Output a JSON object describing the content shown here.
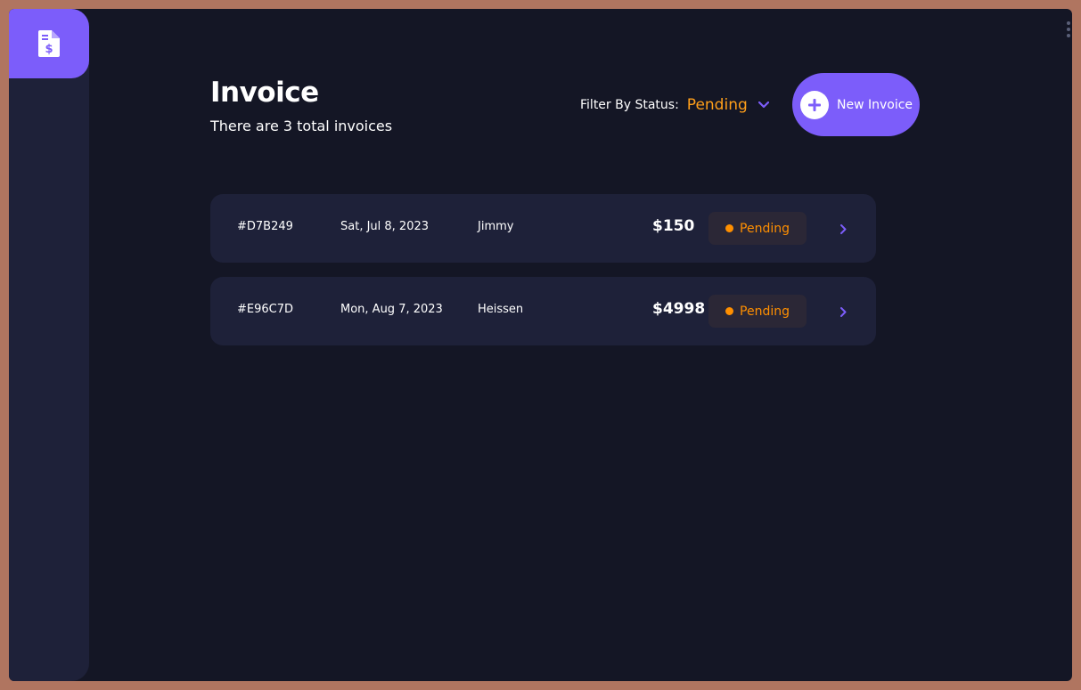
{
  "header": {
    "title": "Invoice",
    "subtitle": "There are 3 total invoices"
  },
  "filter": {
    "label": "Filter By Status:",
    "value": "Pending"
  },
  "new_invoice": {
    "label": "New Invoice"
  },
  "invoices": [
    {
      "id": "#D7B249",
      "date": "Sat, Jul 8, 2023",
      "client": "Jimmy",
      "amount": "$150",
      "status": "Pending"
    },
    {
      "id": "#E96C7D",
      "date": "Mon, Aug 7, 2023",
      "client": "Heissen",
      "amount": "$4998",
      "status": "Pending"
    }
  ],
  "colors": {
    "accent": "#7c5dfa",
    "pending": "#ff8f00",
    "background": "#141625",
    "card": "#1e2139"
  },
  "icons": {
    "logo": "invoice-dollar-icon",
    "filter": "chevron-down-icon",
    "new": "plus-icon",
    "row": "chevron-right-icon"
  }
}
